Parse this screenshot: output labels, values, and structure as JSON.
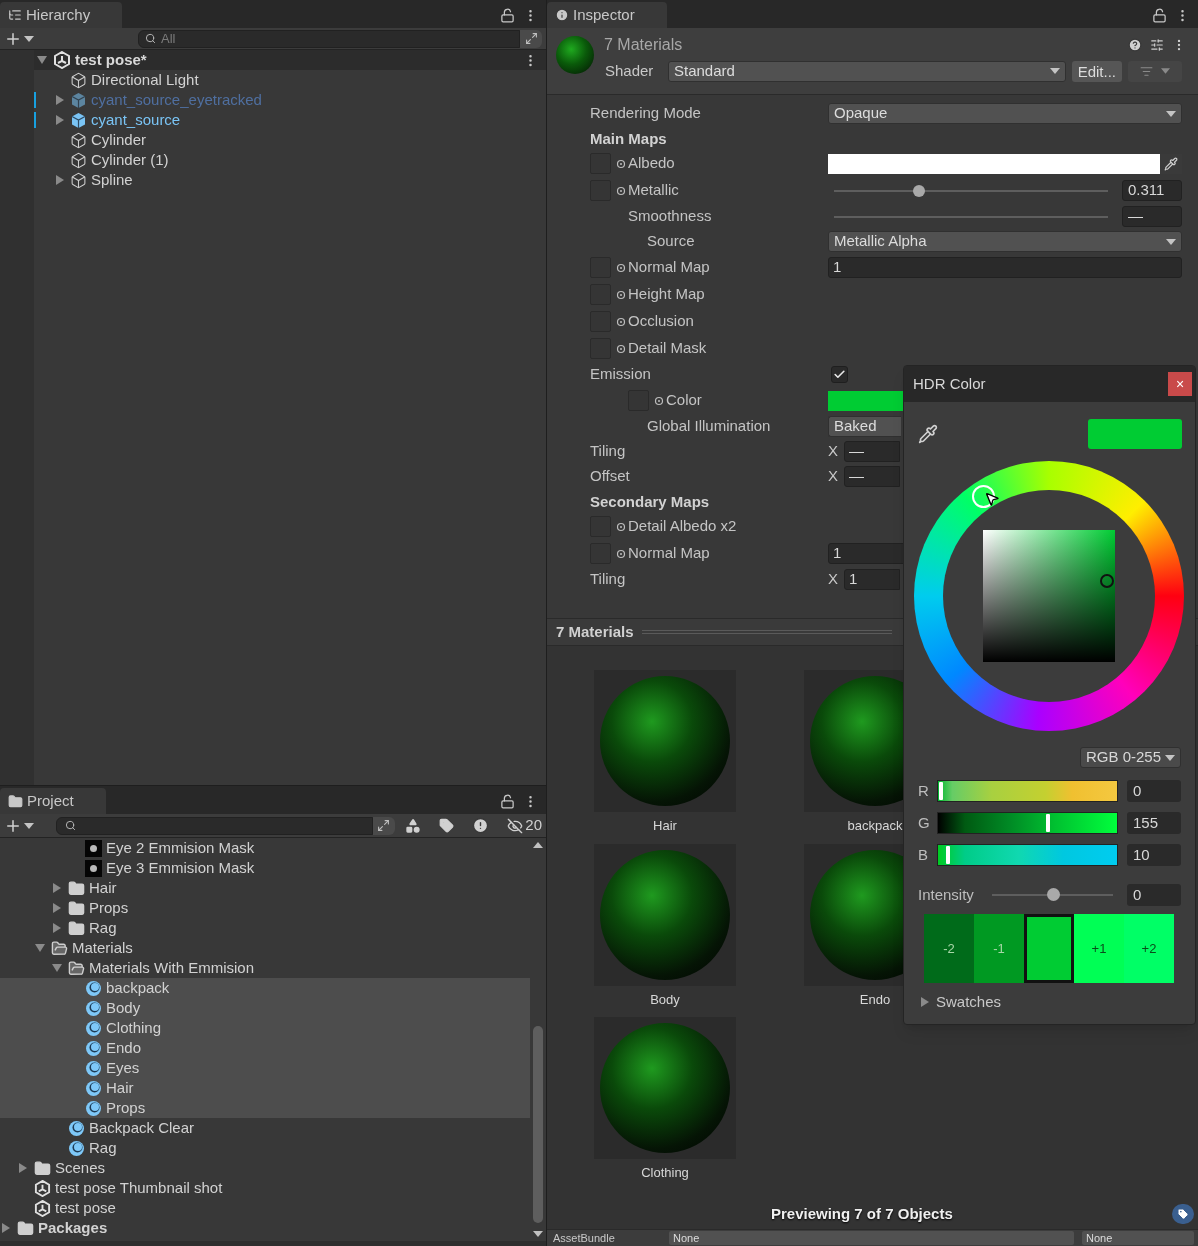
{
  "hierarchy": {
    "title": "Hierarchy",
    "search": {
      "placeholder": "All"
    },
    "scene": {
      "name": "test pose*",
      "expanded": true,
      "children": [
        {
          "name": "Directional Light",
          "kind": "gameobject",
          "active": true
        },
        {
          "name": "cyant_source_eyetracked",
          "kind": "prefab",
          "active": false,
          "expanded": false
        },
        {
          "name": "cyant_source",
          "kind": "prefab",
          "active": true,
          "expanded": false
        },
        {
          "name": "Cylinder",
          "kind": "gameobject",
          "active": true
        },
        {
          "name": "Cylinder (1)",
          "kind": "gameobject",
          "active": true
        },
        {
          "name": "Spline",
          "kind": "gameobject",
          "active": true,
          "expanded": false
        }
      ]
    }
  },
  "project": {
    "title": "Project",
    "hidden_count": "20",
    "tree": [
      {
        "children": [
          {
            "children": [
              {
                "children": [
                  {
                    "children": [
                      {
                        "name": "Eye 2 Emmision Mask",
                        "kind": "texture",
                        "selected": false
                      },
                      {
                        "name": "Eye 3 Emmision Mask",
                        "kind": "texture",
                        "selected": false
                      }
                    ]
                  },
                  {
                    "name": "Hair",
                    "kind": "folder",
                    "expanded": false,
                    "selected": false
                  },
                  {
                    "name": "Props",
                    "kind": "folder",
                    "expanded": false,
                    "selected": false
                  },
                  {
                    "name": "Rag",
                    "kind": "folder",
                    "expanded": false,
                    "selected": false
                  }
                ]
              },
              {
                "name": "Materials",
                "kind": "folder",
                "expanded": true,
                "selected": false,
                "children": [
                  {
                    "name": "Materials With Emmision",
                    "kind": "folder",
                    "expanded": true,
                    "selected": false,
                    "children": [
                      {
                        "name": "backpack",
                        "kind": "material",
                        "selected": true
                      },
                      {
                        "name": "Body",
                        "kind": "material",
                        "selected": true
                      },
                      {
                        "name": "Clothing",
                        "kind": "material",
                        "selected": true
                      },
                      {
                        "name": "Endo",
                        "kind": "material",
                        "selected": true
                      },
                      {
                        "name": "Eyes",
                        "kind": "material",
                        "selected": true
                      },
                      {
                        "name": "Hair",
                        "kind": "material",
                        "selected": true
                      },
                      {
                        "name": "Props",
                        "kind": "material",
                        "selected": true
                      }
                    ]
                  },
                  {
                    "name": "Backpack Clear",
                    "kind": "material",
                    "selected": false
                  },
                  {
                    "name": "Rag",
                    "kind": "material",
                    "selected": false
                  }
                ]
              }
            ]
          },
          {
            "name": "Scenes",
            "kind": "folder",
            "expanded": false,
            "selected": false
          },
          {
            "name": "test pose Thumbnail shot",
            "kind": "scene",
            "selected": false
          },
          {
            "name": "test pose",
            "kind": "scene",
            "selected": false
          }
        ]
      },
      {
        "name": "Packages",
        "kind": "folder",
        "expanded": false,
        "selected": false
      }
    ]
  },
  "inspector": {
    "title": "Inspector",
    "object_title": "7 Materials",
    "shader_label": "Shader",
    "shader": "Standard",
    "edit_button": "Edit...",
    "properties": [
      {
        "kind": "dropdown",
        "label": "Rendering Mode",
        "value": "Opaque"
      },
      {
        "kind": "heading",
        "label": "Main Maps"
      },
      {
        "kind": "texture_color",
        "label": "Albedo",
        "color": "#ffffff"
      },
      {
        "kind": "texture_slider",
        "label": "Metallic",
        "level": 0.311,
        "value": "0.311",
        "children": [
          {
            "kind": "slider",
            "label": "Smoothness",
            "value": "—",
            "children": [
              {
                "kind": "dropdown",
                "label": "Source",
                "value": "Metallic Alpha"
              }
            ]
          }
        ]
      },
      {
        "kind": "texture_field",
        "label": "Normal Map",
        "value": "1"
      },
      {
        "kind": "texture",
        "label": "Height Map"
      },
      {
        "kind": "texture",
        "label": "Occlusion"
      },
      {
        "kind": "texture",
        "label": "Detail Mask"
      },
      {
        "kind": "checkbox",
        "label": "Emission",
        "checked": true,
        "children": [
          {
            "kind": "texture_color",
            "label": "Color",
            "color": "#00cc33",
            "children": [
              {
                "kind": "dropdown",
                "label": "Global Illumination",
                "value": "Baked"
              }
            ]
          }
        ]
      },
      {
        "kind": "vector",
        "label": "Tiling",
        "axis": "X",
        "value": "—"
      },
      {
        "kind": "vector",
        "label": "Offset",
        "axis": "X",
        "value": "—"
      },
      {
        "kind": "heading",
        "label": "Secondary Maps"
      },
      {
        "kind": "texture",
        "label": "Detail Albedo x2"
      },
      {
        "kind": "texture_field",
        "label": "Normal Map",
        "value": "1"
      },
      {
        "kind": "vector",
        "label": "Tiling",
        "axis": "X",
        "value": "1"
      }
    ],
    "preview_title": "7 Materials",
    "previews": [
      "Hair",
      "backpack",
      "Body",
      "Endo",
      "Clothing"
    ],
    "preview_status": "Previewing 7 of 7 Objects",
    "asset_bundle": {
      "label": "AssetBundle",
      "name": "None",
      "variant": "None"
    }
  },
  "color_picker": {
    "title": "HDR Color",
    "close": "×",
    "color": "#00cc33",
    "mode": "RGB 0-255",
    "channels": [
      {
        "label": "R",
        "value": "0",
        "level": 0.0
      },
      {
        "label": "G",
        "value": "155",
        "level": 0.61
      },
      {
        "label": "B",
        "value": "10",
        "level": 0.04
      }
    ],
    "intensity": {
      "label": "Intensity",
      "value": "0",
      "level": 0.5
    },
    "swatches": [
      {
        "label": "-2",
        "color": "#006b1a",
        "selected": false
      },
      {
        "label": "-1",
        "color": "#009922",
        "selected": false
      },
      {
        "color": "#00cc33",
        "selected": true
      },
      {
        "label": "+1",
        "color": "#00ff55",
        "selected": false
      },
      {
        "label": "+2",
        "color": "#00ff66",
        "selected": false
      }
    ],
    "swatches_section": {
      "label": "Swatches",
      "expanded": false
    }
  }
}
